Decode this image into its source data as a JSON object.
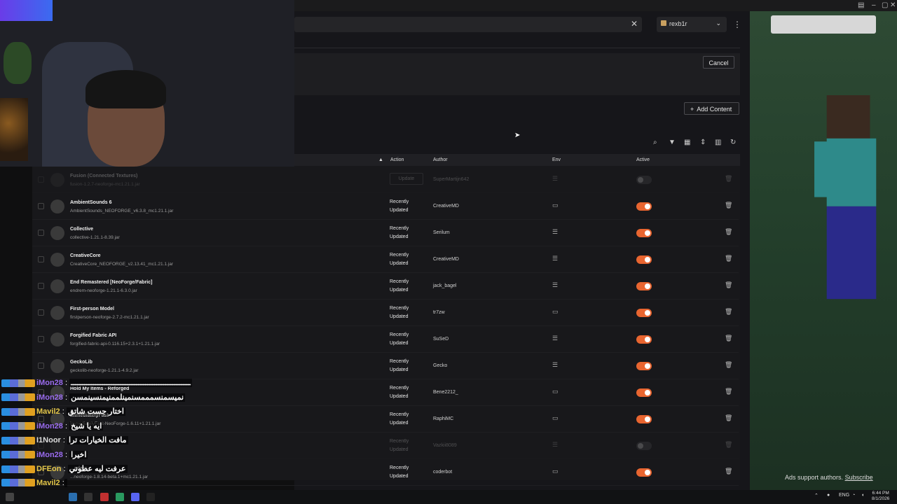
{
  "header": {
    "account": "rexb1r",
    "cancel_label": "Cancel",
    "add_content_label": "Add Content"
  },
  "table": {
    "columns": {
      "action": "Action",
      "author": "Author",
      "env": "Env",
      "active": "Active"
    },
    "rows": [
      {
        "name": "Fusion (Connected Textures)",
        "file": "fusion-1.2.7-neoforge-mc1.21.1.jar",
        "action": "Update",
        "author": "SuperMartijn642",
        "env": "server",
        "active": false,
        "dim": true
      },
      {
        "name": "AmbientSounds 6",
        "file": "AmbientSounds_NEOFORGE_v6.3.8_mc1.21.1.jar",
        "action": "Recently Updated",
        "author": "CreativeMD",
        "env": "client",
        "active": true
      },
      {
        "name": "Collective",
        "file": "collective-1.21.1-8.39.jar",
        "action": "Recently Updated",
        "author": "Serilum",
        "env": "server",
        "active": true
      },
      {
        "name": "CreativeCore",
        "file": "CreativeCore_NEOFORGE_v2.13.41_mc1.21.1.jar",
        "action": "Recently Updated",
        "author": "CreativeMD",
        "env": "server",
        "active": true
      },
      {
        "name": "End Remastered [NeoForge/Fabric]",
        "file": "endrem-neoforge-1.21.1-6.3.0.jar",
        "action": "Recently Updated",
        "author": "jack_bagel",
        "env": "server",
        "active": true
      },
      {
        "name": "First-person Model",
        "file": "firstperson-neoforge-2.7.2-mc1.21.1.jar",
        "action": "Recently Updated",
        "author": "tr7zw",
        "env": "client",
        "active": true
      },
      {
        "name": "Forgified Fabric API",
        "file": "forgified-fabric-api-0.116.15+2.3.1+1.21.1.jar",
        "action": "Recently Updated",
        "author": "SuSeD",
        "env": "server",
        "active": true
      },
      {
        "name": "GeckoLib",
        "file": "geckolib-neoforge-1.21.1-4.9.2.jar",
        "action": "Recently Updated",
        "author": "Gecko",
        "env": "server",
        "active": true
      },
      {
        "name": "Hold My Items - Reforged",
        "file": "",
        "action": "Recently Updated",
        "author": "Bene2212_",
        "env": "client",
        "active": true
      },
      {
        "name": "ImmediatelyFast",
        "file": "ImmediatelyFast-NeoForge-1.6.11+1.21.1.jar",
        "action": "Recently Updated",
        "author": "RaphiMC",
        "env": "client",
        "active": true
      },
      {
        "name": "",
        "file": "",
        "action": "Recently Updated",
        "author": "Vazkii8089",
        "env": "server",
        "active": false,
        "dim": true
      },
      {
        "name": "...aders",
        "file": "...neoforge-1.8.14-beta.1+mc1.21.1.jar",
        "action": "Recently Updated",
        "author": "coderbot",
        "env": "client",
        "active": true
      }
    ]
  },
  "chat": [
    {
      "user": "iMon28",
      "color": "#9b6cf0",
      "text": "ـــــــــــــــــــــــــــــــــــــــــــــــــــــ"
    },
    {
      "user": "iMon28",
      "color": "#9b6cf0",
      "text": "نميسمنسمممسنمينلممنيمنسينمسن"
    },
    {
      "user": "Mavil2",
      "color": "#e6c84a",
      "text": "اختار جست شاتق"
    },
    {
      "user": "iMon28",
      "color": "#9b6cf0",
      "text": "ايه يا شيخ"
    },
    {
      "user": "I1Noor",
      "color": "#dddddd",
      "text": "مافت الخيارات ترا"
    },
    {
      "user": "iMon28",
      "color": "#9b6cf0",
      "text": "اخيرا"
    },
    {
      "user": "DFEon",
      "color": "#e6c84a",
      "text": "عرفت ليه عطوني"
    },
    {
      "user": "Mavil2",
      "color": "#e6c84a",
      "text": ""
    }
  ],
  "ads": {
    "note": "Ads support authors.",
    "link": "Subscribe"
  },
  "tray": {
    "lang": "ENG",
    "time": "6:44 PM",
    "date": "8/1/2026"
  }
}
